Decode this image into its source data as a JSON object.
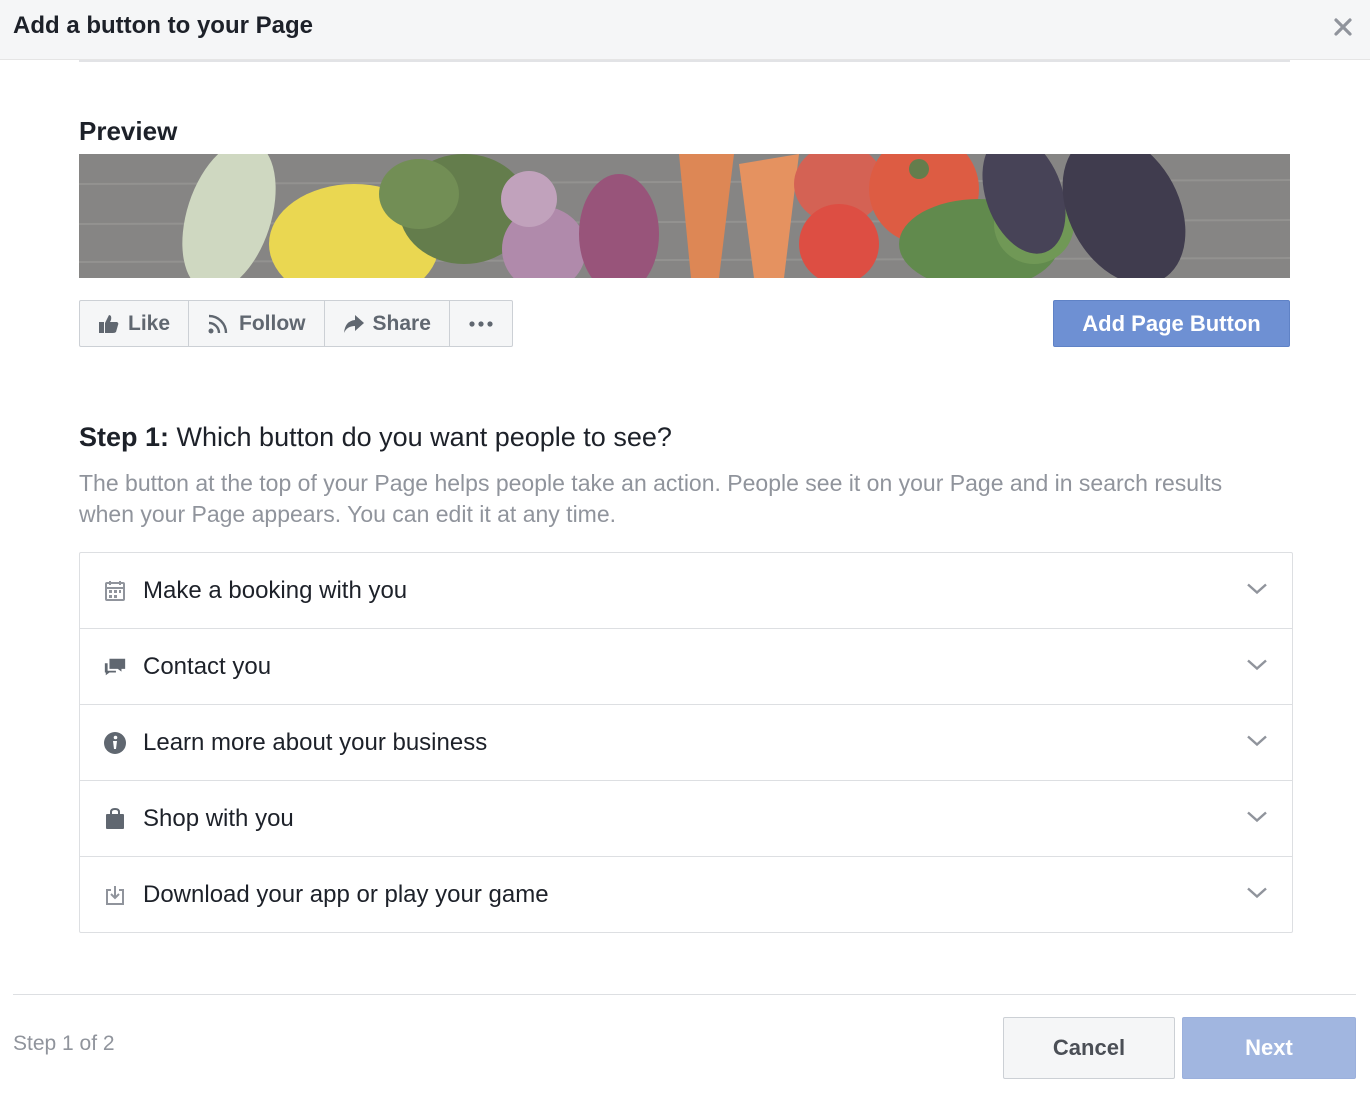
{
  "header": {
    "title": "Add a button to your Page",
    "close_icon": "close-icon"
  },
  "preview": {
    "heading": "Preview",
    "cover_image": "vegetables-cover-photo",
    "actions": [
      {
        "label": "Like",
        "icon": "thumbs-up-icon"
      },
      {
        "label": "Follow",
        "icon": "rss-follow-icon"
      },
      {
        "label": "Share",
        "icon": "share-arrow-icon"
      },
      {
        "label": "",
        "icon": "more-dots-icon"
      }
    ],
    "add_button_label": "Add Page Button"
  },
  "step1": {
    "label": "Step 1:",
    "question": " Which button do you want people to see?",
    "description": "The button at the top of your Page helps people take an action. People see it on your Page and in search results when your Page appears. You can edit it at any time.",
    "options": [
      {
        "label": "Make a booking with you",
        "icon": "calendar-icon"
      },
      {
        "label": "Contact you",
        "icon": "chat-bubbles-icon"
      },
      {
        "label": "Learn more about your business",
        "icon": "info-icon"
      },
      {
        "label": "Shop with you",
        "icon": "shopping-bag-icon"
      },
      {
        "label": "Download your app or play your game",
        "icon": "download-icon"
      }
    ]
  },
  "footer": {
    "step_count": "Step 1 of 2",
    "cancel_label": "Cancel",
    "next_label": "Next"
  },
  "colors": {
    "primary_button": "#6e90d3",
    "disabled_button": "#a1b6e0",
    "muted_text": "#90949c",
    "header_bg": "#f5f6f7"
  }
}
